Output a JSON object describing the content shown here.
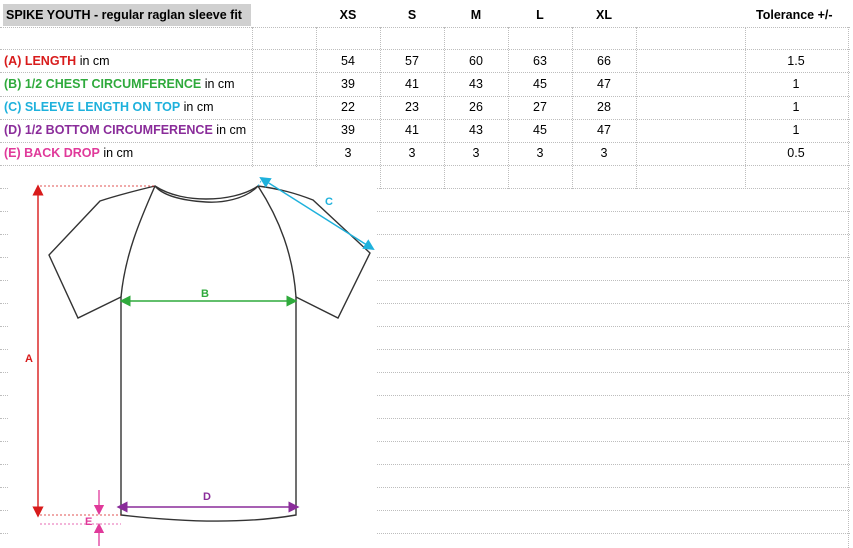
{
  "title": "SPIKE YOUTH - regular raglan sleeve fit",
  "columns": [
    "XS",
    "S",
    "M",
    "L",
    "XL"
  ],
  "tolerance_header": "Tolerance +/-",
  "rows": [
    {
      "code": "(A) LENGTH",
      "unit": " in cm",
      "color": "#d81b1b",
      "values": [
        "54",
        "57",
        "60",
        "63",
        "66"
      ],
      "tolerance": "1.5"
    },
    {
      "code": "(B) 1/2 CHEST CIRCUMFERENCE",
      "unit": " in cm",
      "color": "#2faa3c",
      "values": [
        "39",
        "41",
        "43",
        "45",
        "47"
      ],
      "tolerance": "1"
    },
    {
      "code": "(C) SLEEVE LENGTH ON TOP",
      "unit": " in cm",
      "color": "#1eb1dc",
      "values": [
        "22",
        "23",
        "26",
        "27",
        "28"
      ],
      "tolerance": "1"
    },
    {
      "code": "(D) 1/2 BOTTOM CIRCUMFERENCE",
      "unit": " in cm",
      "color": "#8a2c9a",
      "values": [
        "39",
        "41",
        "43",
        "45",
        "47"
      ],
      "tolerance": "1"
    },
    {
      "code": "(E) BACK DROP",
      "unit": " in cm",
      "color": "#e0399a",
      "values": [
        "3",
        "3",
        "3",
        "3",
        "3"
      ],
      "tolerance": "0.5"
    }
  ],
  "diagram": {
    "label_a": "A",
    "label_b": "B",
    "label_c": "C",
    "label_d": "D",
    "label_e": "E"
  }
}
